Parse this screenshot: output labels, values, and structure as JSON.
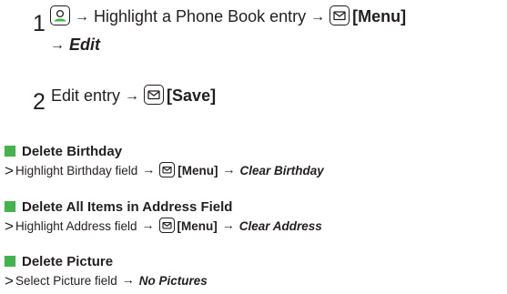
{
  "step1": {
    "number": "1",
    "text_highlight": "Highlight a Phone Book entry",
    "text_menu": "[Menu]",
    "text_edit": "Edit",
    "arrow": "→"
  },
  "step2": {
    "number": "2",
    "text_edit_entry": "Edit entry",
    "text_save": "[Save]",
    "arrow": "→"
  },
  "sections": [
    {
      "heading": "Delete Birthday",
      "line_start": "Highlight Birthday field",
      "line_menu": "[Menu]",
      "line_end": "Clear Birthday"
    },
    {
      "heading": "Delete All Items in Address Field",
      "line_start": "Highlight Address field",
      "line_menu": "[Menu]",
      "line_end": "Clear Address"
    },
    {
      "heading": "Delete Picture",
      "line_start": "Select Picture field",
      "line_end": "No Pictures"
    }
  ],
  "marker": ">",
  "arrow": "→",
  "colors": {
    "accent": "#3fb54a",
    "text": "#231f20"
  },
  "icons": {
    "contacts_key": "phonebook-key-icon",
    "mail_key": "mail-key-icon"
  }
}
